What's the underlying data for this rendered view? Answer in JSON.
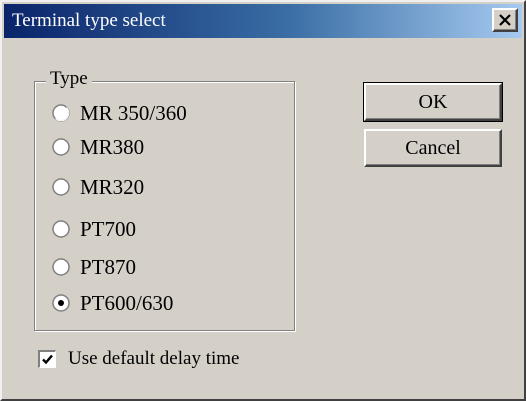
{
  "window": {
    "title": "Terminal type select",
    "close_icon": "close-icon"
  },
  "type_group": {
    "legend": "Type",
    "options": [
      {
        "label": "MR 350/360",
        "selected": false
      },
      {
        "label": "MR380",
        "selected": false
      },
      {
        "label": "MR320",
        "selected": false
      },
      {
        "label": "PT700",
        "selected": false
      },
      {
        "label": "PT870",
        "selected": false
      },
      {
        "label": "PT600/630",
        "selected": true
      }
    ]
  },
  "buttons": {
    "ok_label": "OK",
    "cancel_label": "Cancel"
  },
  "delay_checkbox": {
    "label": "Use default delay time",
    "checked": true
  },
  "colors": {
    "face": "#d4d0c8",
    "title_start": "#0a246a",
    "title_end": "#a6caf0"
  }
}
